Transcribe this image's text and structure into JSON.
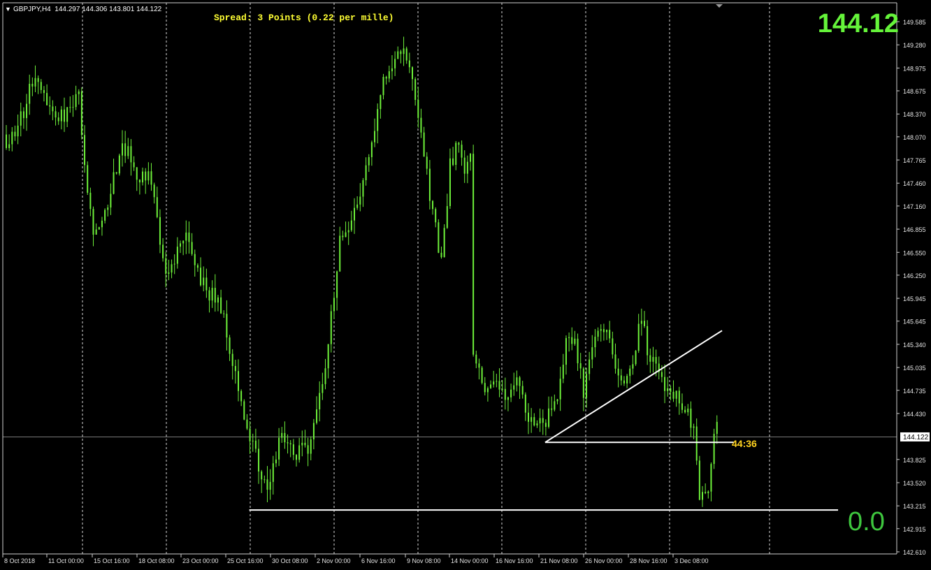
{
  "header": {
    "menu_symbol": "▼",
    "symbol_ohlc": "GBPJPY,H4  144.297 144.306 143.801 144.122",
    "spread_text": "Spread: 3 Points (0.22 per mille)",
    "big_price": "144.12",
    "countdown": "44:36",
    "zero_label": "0.0"
  },
  "colors": {
    "background": "#000000",
    "candle": "#6ef23a",
    "grid": "#d9d9d9",
    "price_line": "#7a7a7a",
    "axis_text": "#e6e6e6",
    "spread_text": "#ffff33",
    "big_price": "#65f43a",
    "countdown": "#ffd21f",
    "zero_label": "#3ec63e",
    "trendline": "#ffffff"
  },
  "chart_data": {
    "type": "candlestick",
    "symbol": "GBPJPY",
    "timeframe": "H4",
    "ylim": [
      142.61,
      149.585
    ],
    "y_ticks": [
      "149.585",
      "149.280",
      "148.975",
      "148.675",
      "148.370",
      "148.070",
      "147.765",
      "147.460",
      "147.160",
      "146.855",
      "146.550",
      "146.250",
      "145.945",
      "145.645",
      "145.340",
      "145.035",
      "144.735",
      "144.430",
      "144.122",
      "143.825",
      "143.520",
      "143.215",
      "142.915",
      "142.610"
    ],
    "current_price": "144.122",
    "x_labels": [
      "8 Oct 2018",
      "11 Oct 00:00",
      "15 Oct 16:00",
      "18 Oct 08:00",
      "23 Oct 00:00",
      "25 Oct 16:00",
      "30 Oct 08:00",
      "2 Nov 00:00",
      "6 Nov 16:00",
      "9 Nov 08:00",
      "14 Nov 00:00",
      "16 Nov 16:00",
      "21 Nov 08:00",
      "26 Nov 00:00",
      "28 Nov 16:00",
      "3 Dec 08:00"
    ],
    "anchors": [
      [
        0,
        148.0
      ],
      [
        5,
        148.3
      ],
      [
        10,
        148.9
      ],
      [
        15,
        148.5
      ],
      [
        20,
        148.3
      ],
      [
        25,
        148.6
      ],
      [
        28,
        147.3
      ],
      [
        30,
        146.8
      ],
      [
        35,
        147.2
      ],
      [
        40,
        148.0
      ],
      [
        45,
        147.6
      ],
      [
        50,
        147.5
      ],
      [
        55,
        146.2
      ],
      [
        58,
        146.5
      ],
      [
        62,
        146.9
      ],
      [
        64,
        146.5
      ],
      [
        67,
        146.2
      ],
      [
        70,
        146.0
      ],
      [
        73,
        146.0
      ],
      [
        76,
        145.5
      ],
      [
        80,
        144.7
      ],
      [
        85,
        144.0
      ],
      [
        88,
        143.6
      ],
      [
        90,
        143.5
      ],
      [
        95,
        144.2
      ],
      [
        100,
        143.9
      ],
      [
        104,
        144.0
      ],
      [
        110,
        145.0
      ],
      [
        115,
        146.7
      ],
      [
        118,
        146.8
      ],
      [
        122,
        147.3
      ],
      [
        126,
        147.9
      ],
      [
        130,
        148.8
      ],
      [
        134,
        149.1
      ],
      [
        137,
        149.3
      ],
      [
        140,
        148.8
      ],
      [
        143,
        148.2
      ],
      [
        146,
        147.3
      ],
      [
        150,
        146.4
      ],
      [
        153,
        147.7
      ],
      [
        156,
        148.0
      ],
      [
        158,
        147.6
      ],
      [
        160,
        147.8
      ],
      [
        161,
        145.2
      ],
      [
        165,
        144.7
      ],
      [
        168,
        144.9
      ],
      [
        172,
        144.6
      ],
      [
        176,
        144.9
      ],
      [
        180,
        144.4
      ],
      [
        185,
        144.3
      ],
      [
        190,
        144.6
      ],
      [
        193,
        145.4
      ],
      [
        196,
        145.4
      ],
      [
        199,
        144.7
      ],
      [
        202,
        145.2
      ],
      [
        205,
        145.6
      ],
      [
        208,
        145.4
      ],
      [
        210,
        145.0
      ],
      [
        214,
        144.9
      ],
      [
        217,
        145.3
      ],
      [
        219,
        145.7
      ],
      [
        221,
        145.3
      ],
      [
        224,
        145.0
      ],
      [
        228,
        144.7
      ],
      [
        232,
        144.6
      ],
      [
        235,
        144.4
      ],
      [
        237,
        144.2
      ],
      [
        239,
        143.3
      ],
      [
        242,
        143.5
      ],
      [
        245,
        144.4
      ]
    ],
    "total_bars": 246,
    "annotations": [
      {
        "type": "trendline",
        "from": {
          "bar": 186,
          "price": 144.05
        },
        "to": {
          "bar": 247,
          "price": 145.52
        }
      },
      {
        "type": "hline",
        "price": 144.05,
        "from_bar": 186,
        "to_bar": 251,
        "label": "44:36"
      },
      {
        "type": "hline",
        "price": 143.16,
        "from_bar": 84,
        "to_bar": 287,
        "label": "0.0"
      }
    ]
  }
}
